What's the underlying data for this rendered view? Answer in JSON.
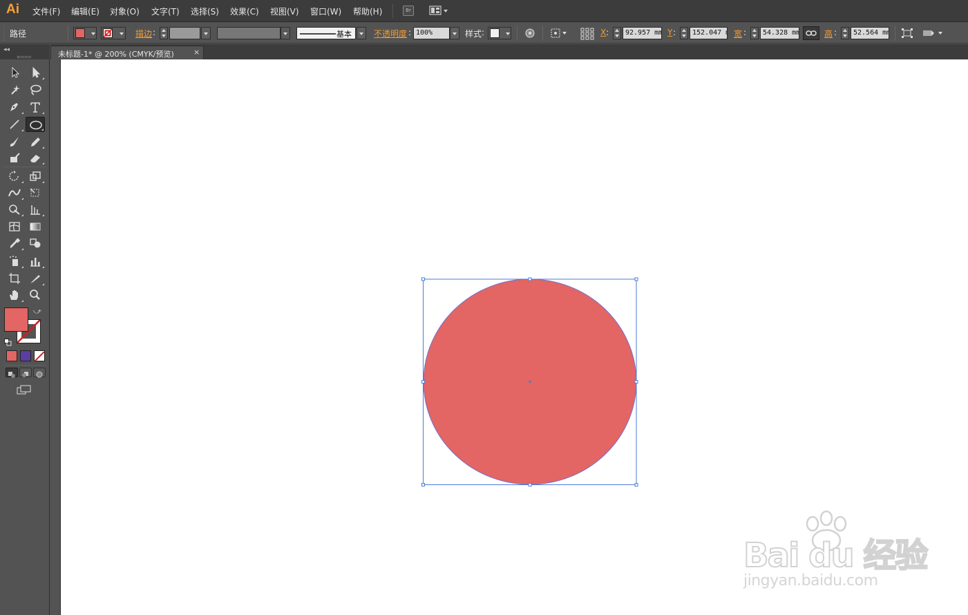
{
  "app": {
    "logo": "Ai",
    "menu": [
      "文件(F)",
      "编辑(E)",
      "对象(O)",
      "文字(T)",
      "选择(S)",
      "效果(C)",
      "视图(V)",
      "窗口(W)",
      "帮助(H)"
    ],
    "bridge_button": "Br",
    "workspace_icon": "workspace-layout-icon"
  },
  "control_bar": {
    "selection_type": "路径",
    "fill_color": "#e36564",
    "stroke_label": "描边",
    "stroke_style_label": "基本",
    "opacity_label": "不透明度",
    "opacity_value": "100%",
    "style_label": "样式",
    "x_label": "X",
    "x_value": "92.957 mm",
    "y_label": "Y",
    "y_value": "152.047 mm",
    "w_label": "宽",
    "w_value": "54.328 mm",
    "h_label": "高",
    "h_value": "52.564 mm"
  },
  "toolbar": {
    "fill_color": "#e36564",
    "tools": [
      "selection-tool",
      "direct-selection-tool",
      "magic-wand-tool",
      "lasso-tool",
      "pen-tool",
      "type-tool",
      "line-segment-tool",
      "ellipse-tool",
      "paintbrush-tool",
      "pencil-tool",
      "blob-brush-tool",
      "eraser-tool",
      "rotate-tool",
      "scale-tool",
      "width-tool",
      "free-transform-tool",
      "shape-builder-tool",
      "perspective-grid-tool",
      "mesh-tool",
      "gradient-tool",
      "eyedropper-tool",
      "blend-tool",
      "symbol-sprayer-tool",
      "column-graph-tool",
      "artboard-tool",
      "slice-tool",
      "hand-tool",
      "zoom-tool"
    ],
    "active_tool": "ellipse-tool"
  },
  "document": {
    "tab_title": "未标题-1* @ 200% (CMYK/预览)",
    "close_glyph": "×"
  },
  "artwork": {
    "shape": "ellipse",
    "fill": "#e36564",
    "selection_color": "#4a7bd6"
  },
  "watermark": {
    "logo_text": "Bai du 经验",
    "url_text": "jingyan.baidu.com"
  }
}
